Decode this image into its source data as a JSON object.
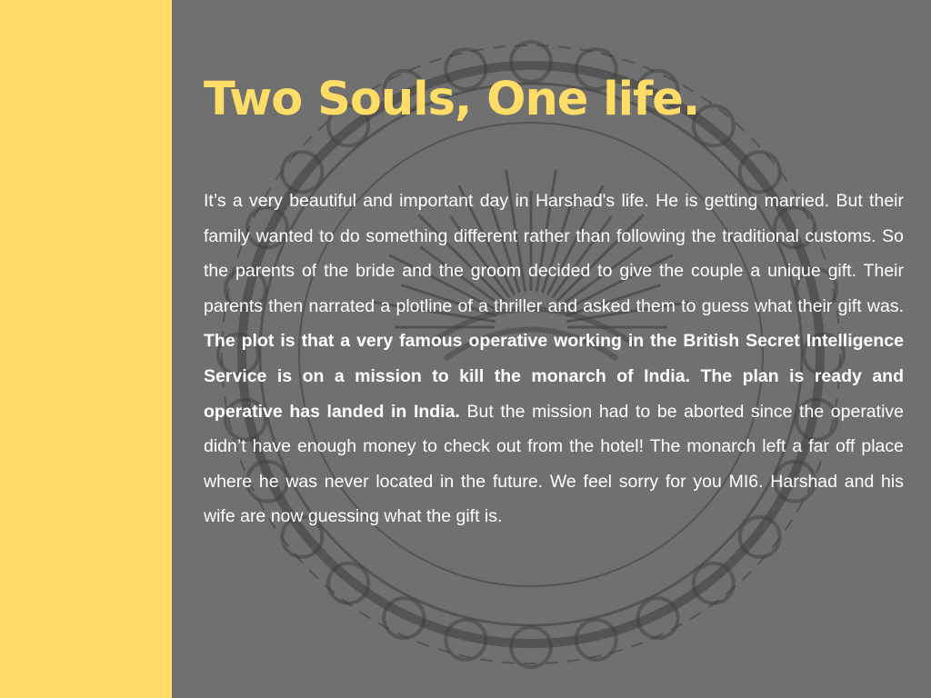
{
  "slide": {
    "title": "Two Souls, One life.",
    "paragraph": {
      "intro": "It’s a very beautiful and important day in Harshad's life. He is getting married. But their family wanted to do something different rather than following the traditional customs. So the parents of the bride and the groom decided to give the couple a unique gift. Their parents then narrated a plotline of a thriller and asked them to guess what their gift was. ",
      "emphasis": "The plot is that a very famous operative working in the British Secret Intelligence Service is on a mission to kill the monarch of India. The plan is ready and operative has landed in India.",
      "outro": " But the mission had to be aborted since the operative didn’t have enough money to check out from the hotel! The monarch left a far off place where he was never located in the future. We feel sorry for you MI6. Harshad and his wife are now guessing what the gift is."
    }
  },
  "colors": {
    "accent": "#ffdd67",
    "panel": "#707070",
    "text": "#ffffff",
    "ornament": "#3a3a3a"
  },
  "decorations": {
    "background_ornament": "mandala-ornament"
  }
}
